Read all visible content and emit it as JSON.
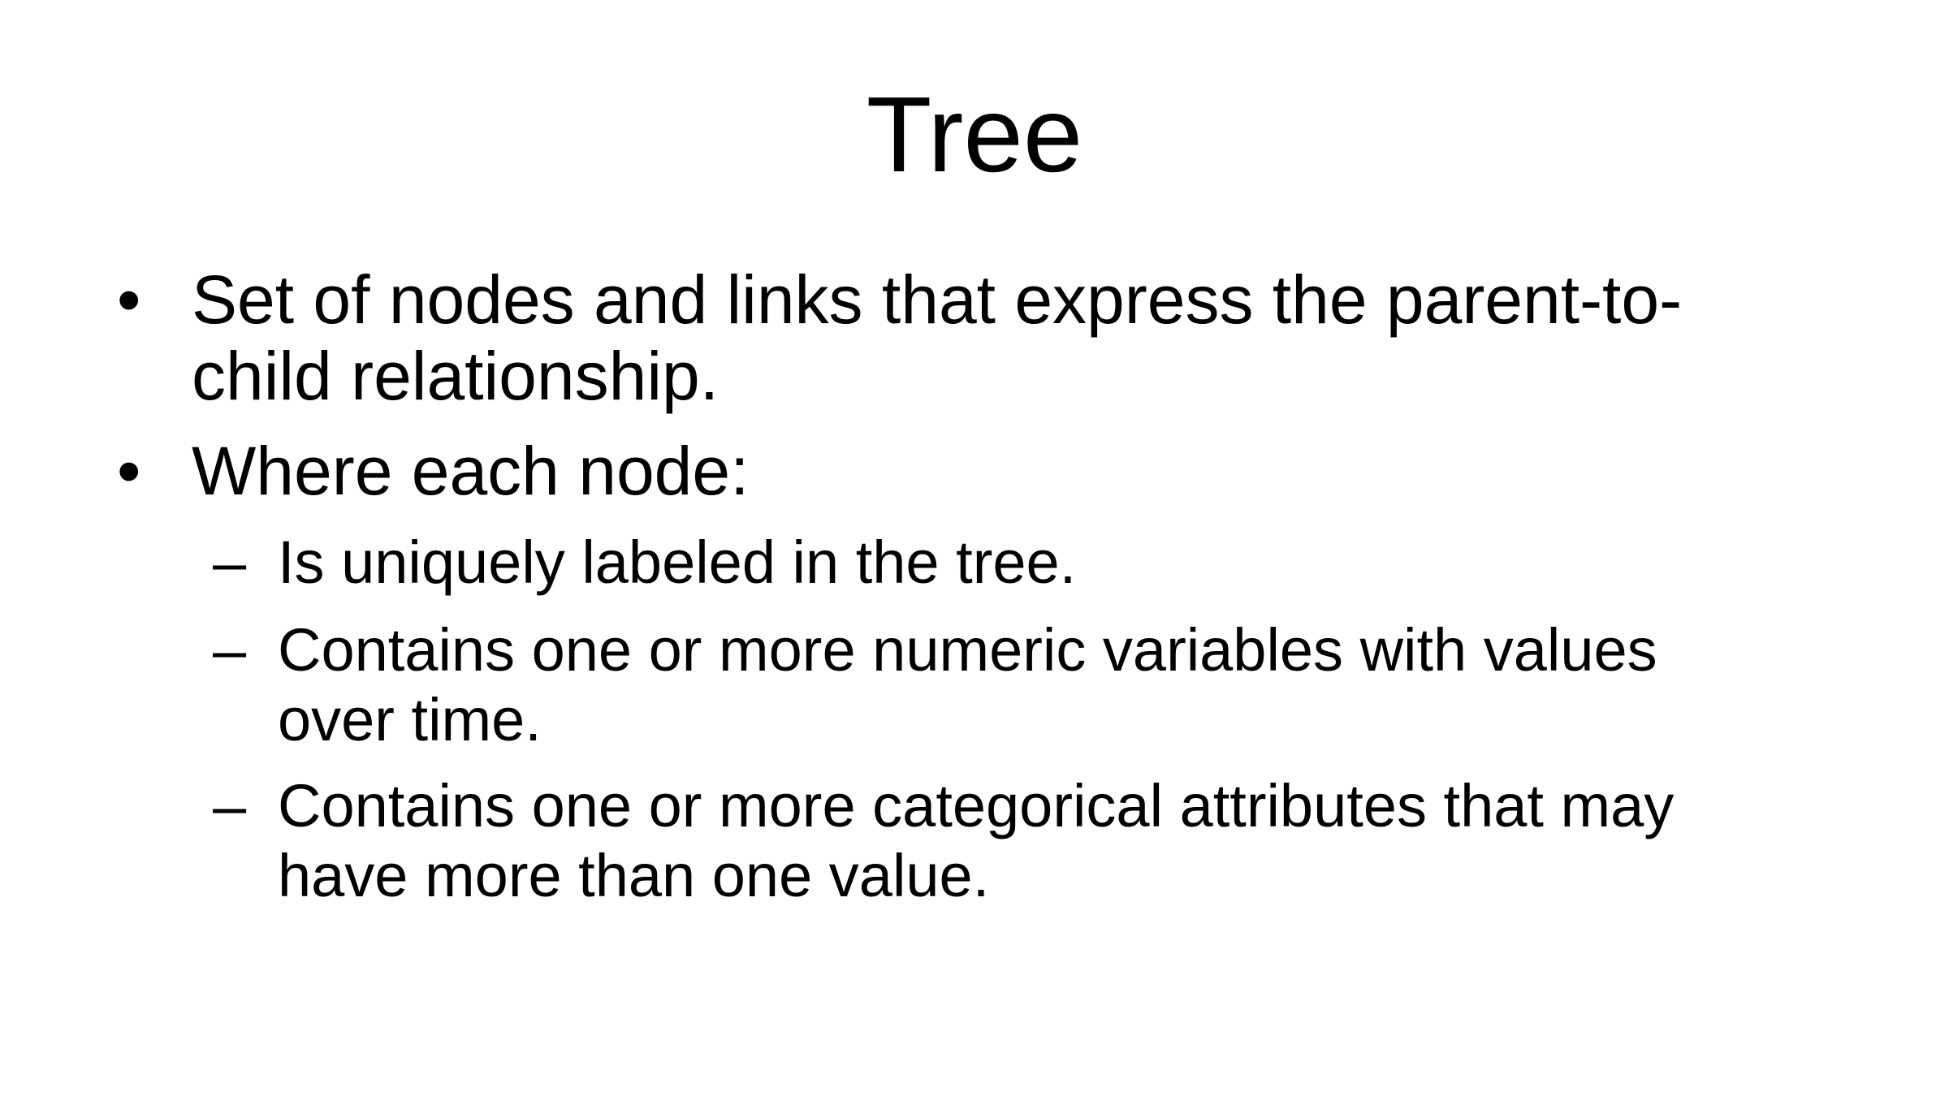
{
  "slide": {
    "title": "Tree",
    "bullet_symbol": "•",
    "sub_bullet_symbol": "–",
    "bullets": [
      {
        "text": "Set of nodes and links that express the parent-to-\nchild relationship."
      },
      {
        "text": "Where each node:"
      }
    ],
    "sub_bullets": [
      {
        "text": "Is uniquely labeled in the tree."
      },
      {
        "text": "Contains one or more numeric variables with values\nover time."
      },
      {
        "text": "Contains one or more categorical attributes that may\nhave more than one value."
      }
    ]
  }
}
